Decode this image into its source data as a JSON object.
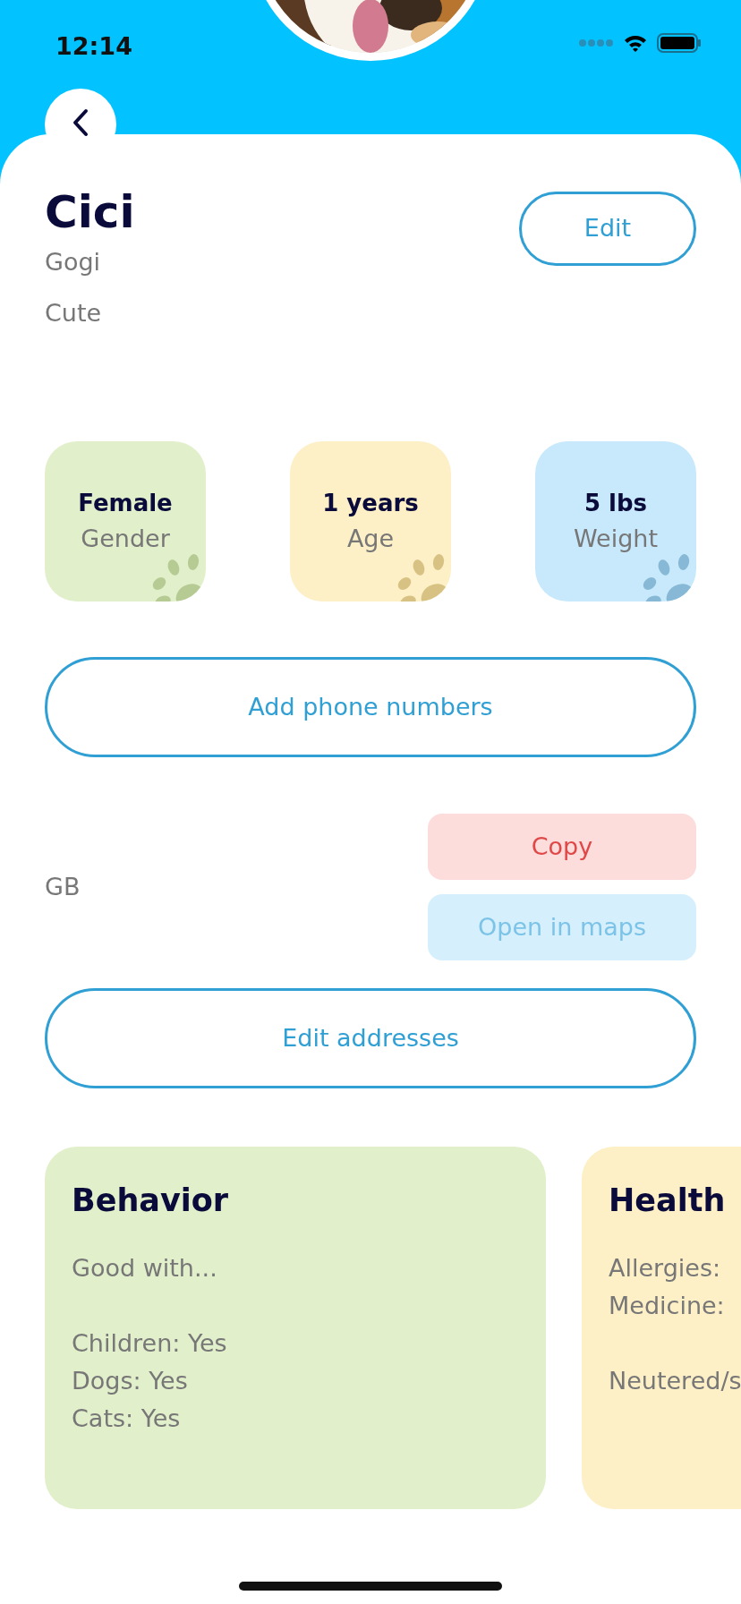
{
  "status_bar": {
    "time": "12:14"
  },
  "pet": {
    "name": "Cici",
    "breed": "Gogi",
    "description": "Cute"
  },
  "edit_button": "Edit",
  "stats": [
    {
      "value": "Female",
      "label": "Gender",
      "color": "#e1efca"
    },
    {
      "value": "1 years",
      "label": "Age",
      "color": "#fdefc6"
    },
    {
      "value": "5 lbs",
      "label": "Weight",
      "color": "#c8e9fc"
    }
  ],
  "phone_button": "Add phone numbers",
  "address": {
    "country": "GB",
    "actions": [
      {
        "label": "Copy",
        "kind": "danger"
      },
      {
        "label": "Open in maps",
        "kind": "info"
      }
    ]
  },
  "address_button": "Edit addresses",
  "info_cards": [
    {
      "title": "Behavior",
      "color": "#e1efca",
      "groups": [
        [
          "Good with..."
        ],
        [
          "Children: Yes",
          "Dogs: Yes",
          "Cats: Yes"
        ]
      ]
    },
    {
      "title": "Health",
      "color": "#fdefc6",
      "groups": [
        [
          "Allergies:",
          "Medicine:"
        ],
        [
          "Neutered/s"
        ]
      ]
    }
  ]
}
